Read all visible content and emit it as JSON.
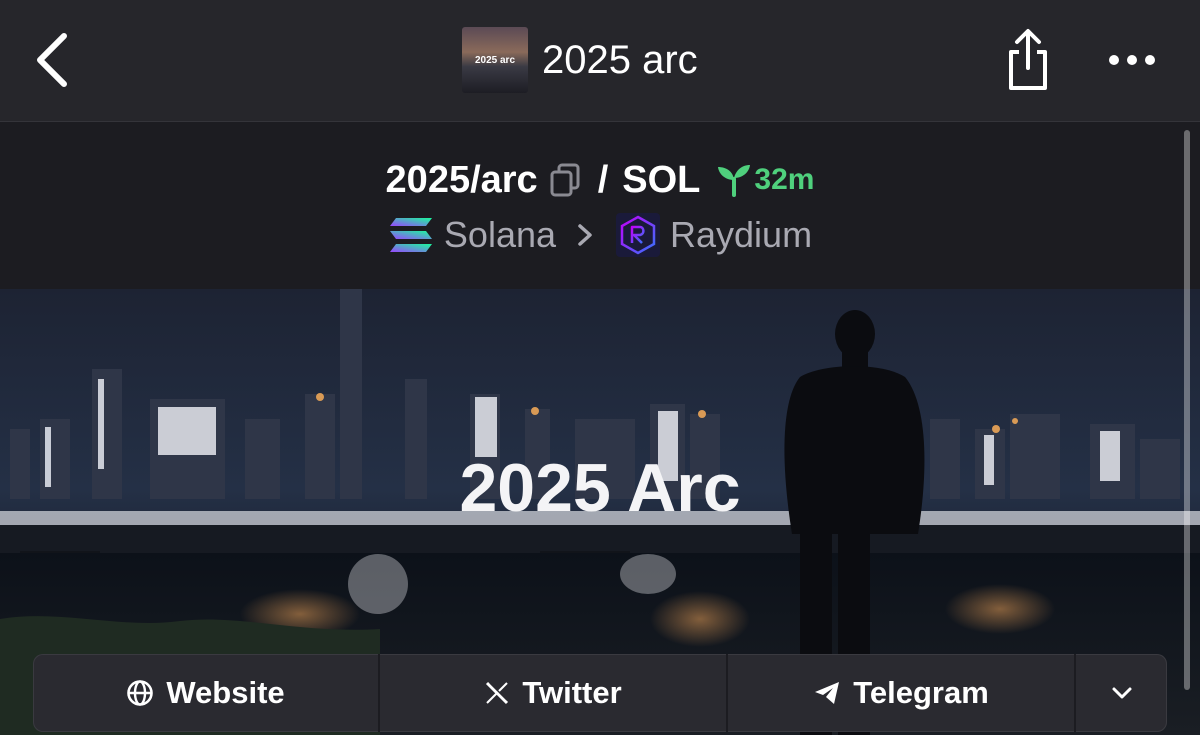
{
  "header": {
    "title": "2025 arc",
    "thumbnail_text": "2025 arc",
    "back_icon": "chevron-left-icon",
    "share_icon": "share-icon",
    "more_icon": "more-horizontal-icon"
  },
  "pair": {
    "base": "2025/arc",
    "separator": "/",
    "quote": "SOL",
    "age": "32m",
    "age_color": "#4fd07d",
    "chain": "Solana",
    "dex": "Raydium"
  },
  "banner": {
    "overlay_text": "2025 Arc"
  },
  "links": {
    "website": "Website",
    "twitter": "Twitter",
    "telegram": "Telegram"
  },
  "colors": {
    "background": "#1b1b20",
    "topbar": "#26262b",
    "accent_green": "#4fd07d"
  }
}
